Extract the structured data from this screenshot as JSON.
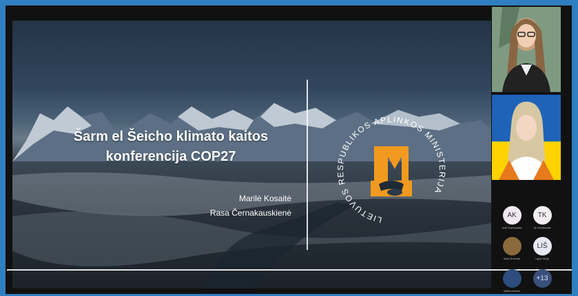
{
  "slide": {
    "title_line1": "Šarm el Šeicho klimato kaitos",
    "title_line2": "konferencija COP27",
    "author1": "Marilė Kosaitė",
    "author2": "Rasa Černakauskienė",
    "emblem_text": "LIETUVOS RESPUBLIKOS APLINKOS MINISTERIJA",
    "accent_color": "#f29a1f"
  },
  "participants": [
    {
      "initials": "AK",
      "name": "Adel Kazeckaite",
      "color": "#f0e8f2"
    },
    {
      "initials": "TK",
      "name": "Tip Kerdavaite",
      "color": "#f4eef2"
    },
    {
      "initials": "",
      "name": "Ideal Snieuite",
      "color": "#8a6a3c"
    },
    {
      "initials": "LIŠ",
      "name": "Ugne Sirija",
      "color": "#e6e9f4"
    },
    {
      "initials": "",
      "name": "Vaitkauskiene",
      "color": "#2c4d7d"
    },
    {
      "initials": "+13",
      "name": "",
      "color": "#3a4f7a"
    }
  ]
}
